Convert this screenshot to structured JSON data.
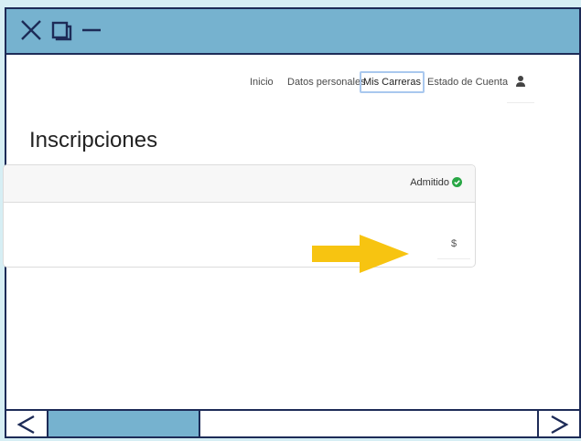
{
  "window": {
    "controls": [
      "close-icon",
      "maximize-icon",
      "minimize-icon"
    ],
    "accent": "#76b2cf",
    "border": "#1d2b57"
  },
  "nav": {
    "items": [
      {
        "label": "Inicio"
      },
      {
        "label": "Datos personales"
      },
      {
        "label": "Mis Carreras",
        "active": true
      },
      {
        "label": "Estado de Cuenta"
      }
    ],
    "user_icon": "user-icon"
  },
  "page": {
    "title": "Inscripciones"
  },
  "card": {
    "status": "Admitido",
    "status_icon": "check-circle-icon",
    "status_color": "#28a745",
    "amount_label": "$",
    "arrow_color": "#f7c411"
  },
  "scrollbar": {
    "left": "<",
    "right": ">"
  }
}
